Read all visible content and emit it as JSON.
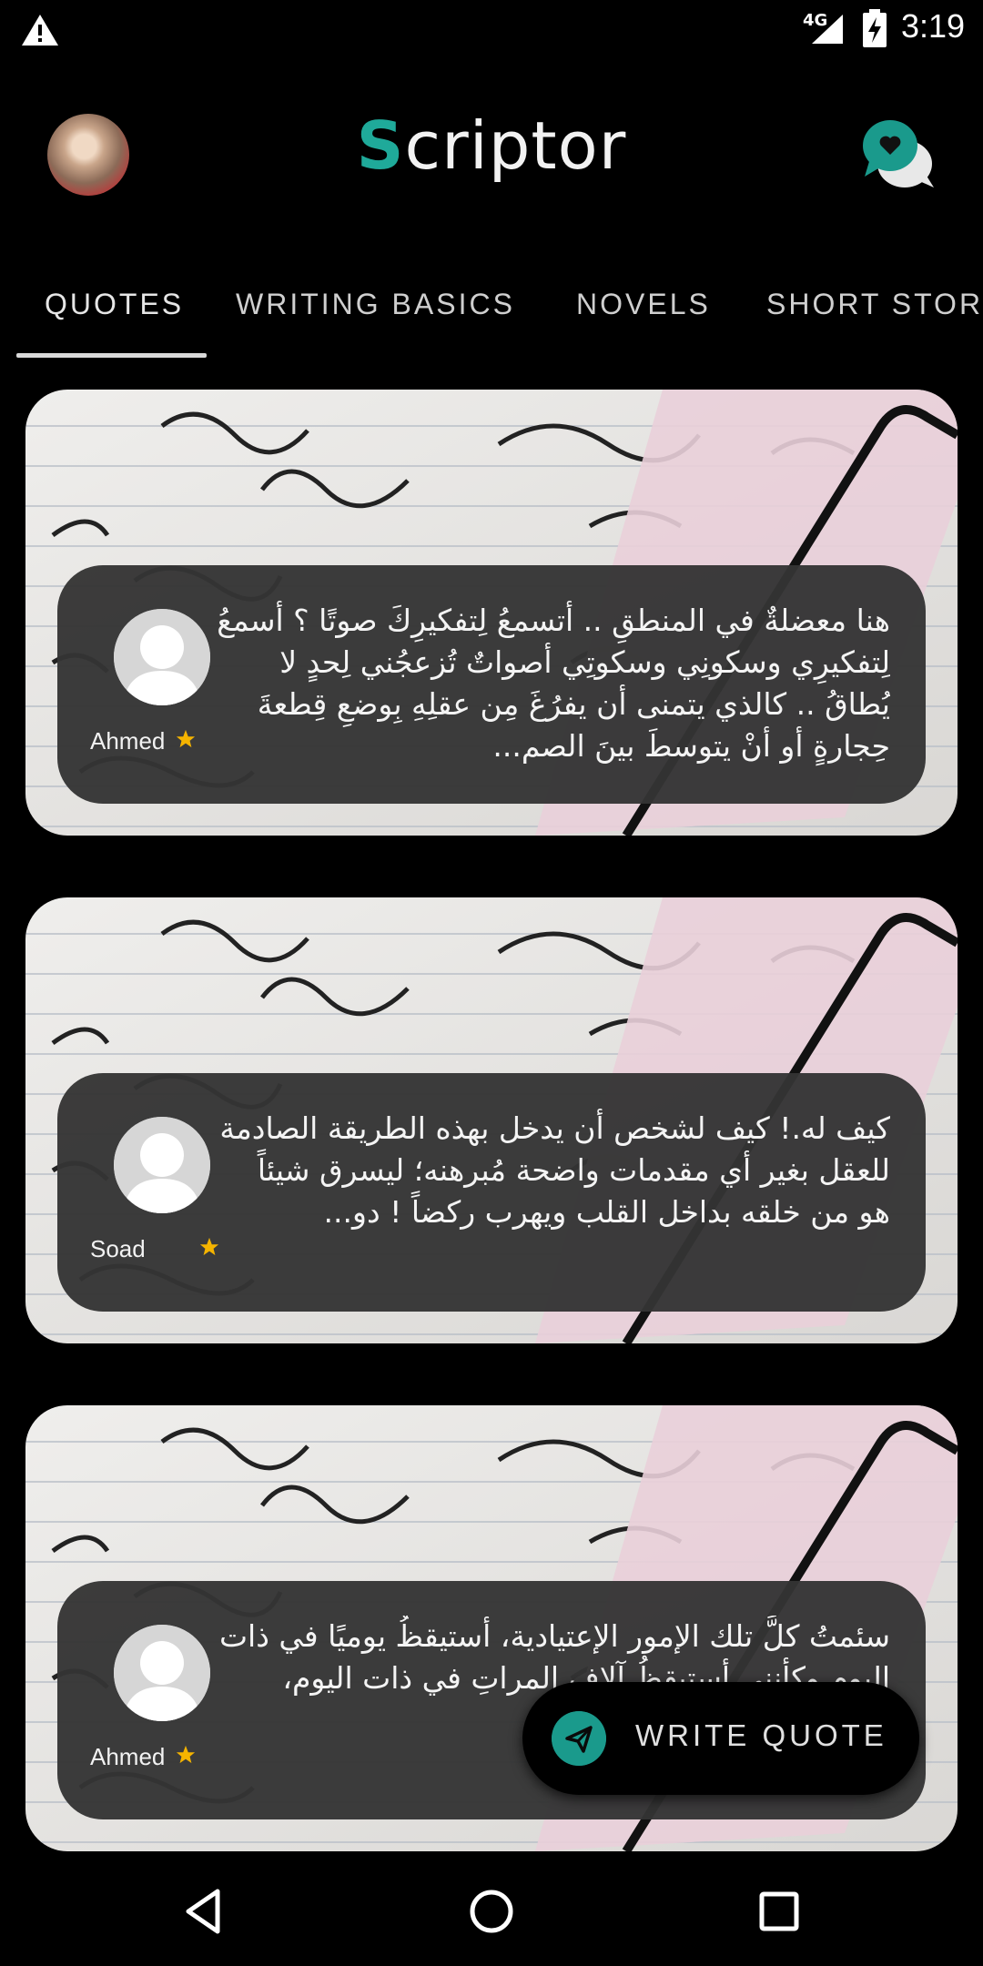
{
  "status_bar": {
    "network": "4G",
    "time": "3:19"
  },
  "header": {
    "title_first": "S",
    "title_rest": "criptor"
  },
  "tabs": [
    {
      "label": "QUOTES",
      "active": true
    },
    {
      "label": "WRITING BASICS",
      "active": false
    },
    {
      "label": "NOVELS",
      "active": false
    },
    {
      "label": "SHORT STOR",
      "active": false
    }
  ],
  "quotes": [
    {
      "author": "Ahmed",
      "text": "هنا معضلةٌ في المنطقِ .. أتسمعُ لِتفكيرِكَ صوتًا ؟ أسمعُ لِتفكيرِي وسكونِي وسكوتِي أصواتٌ تُزعجُني لِحدٍ لا يُطاقُ .. كالذي يتمنى أن يفرُغَ مِن عقلِهِ بِوضعِ قِطعةَ حِجارةٍ أو أنْ يتوسطَ بينَ الصم..."
    },
    {
      "author": "Soad",
      "text": "كيف له.! كيف لشخص أن يدخل بهذه الطريقة الصادمة للعقل بغير أي مقدمات واضحة مُبرهنه؛ ليسرق شيئاً هو من خلقه بداخل القلب ويهرب ركضاً ! دو..."
    },
    {
      "author": "Ahmed",
      "text": "سئمتُ كلَّ تلك الإمور الإعتيادية، أستيقظُ يوميًا في ذات اليوم وكأنني أستيقظُ آلاف المراتِ في ذات اليوم، للدرجةِ التي لا جدوى..."
    }
  ],
  "fab": {
    "label": "WRITE QUOTE"
  },
  "colors": {
    "accent": "#1faa9a",
    "star": "#f5b400",
    "card_overlay": "#343434"
  }
}
